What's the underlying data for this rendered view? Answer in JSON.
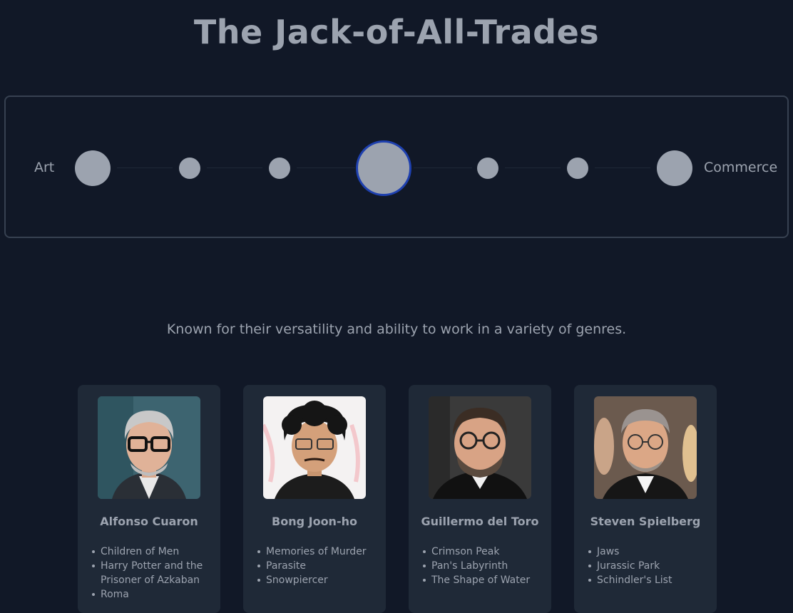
{
  "page": {
    "title": "The Jack-of-All-Trades",
    "description": "Known for their versatility and ability to work in a variety of genres."
  },
  "spectrum": {
    "left_label": "Art",
    "right_label": "Commerce",
    "node_count": 7,
    "selected_index": 3
  },
  "directors": [
    {
      "name": "Alfonso Cuaron",
      "photo_icon": "director-portrait",
      "films": [
        "Children of Men",
        "Harry Potter and the Prisoner of Azkaban",
        "Roma"
      ]
    },
    {
      "name": "Bong Joon-ho",
      "photo_icon": "director-portrait",
      "films": [
        "Memories of Murder",
        "Parasite",
        "Snowpiercer"
      ]
    },
    {
      "name": "Guillermo del Toro",
      "photo_icon": "director-portrait",
      "films": [
        "Crimson Peak",
        "Pan's Labyrinth",
        "The Shape of Water"
      ]
    },
    {
      "name": "Steven Spielberg",
      "photo_icon": "director-portrait",
      "films": [
        "Jaws",
        "Jurassic Park",
        "Schindler's List"
      ]
    }
  ],
  "colors": {
    "background": "#111827",
    "card": "#1f2937",
    "text": "#9ca3af",
    "selected_ring": "#1e40af"
  }
}
